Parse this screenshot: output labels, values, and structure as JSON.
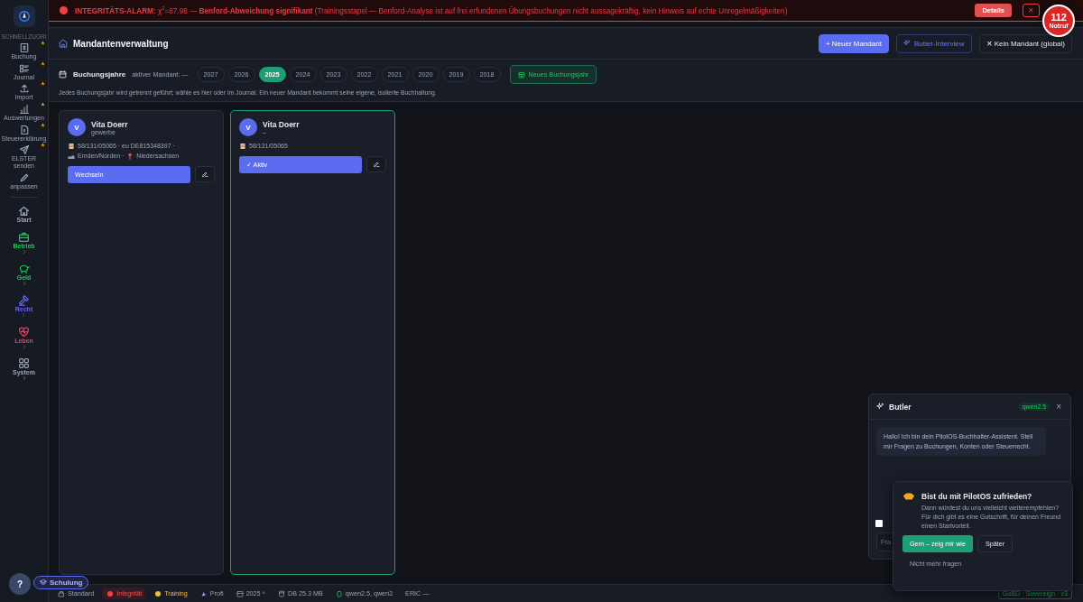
{
  "alarm": {
    "message": "**INTEGRITÄTS-ALARM:** χ$^{2}$=87.98 — **Benford-Abweichung signifikant** (Trainingsstapel — Benford-Analyse ist auf frei erfundenen Übungsbuchungen nicht aussagekräftig, kein Hinweis auf echte Unregelmäßigkeiten)",
    "details_button": "Details",
    "close_button": "✕"
  },
  "emergency": {
    "number": "112",
    "label": "Notruf"
  },
  "sidebar": {
    "section": "SCHNELLZUGRI",
    "quick": [
      {
        "label": "Buchung",
        "starred": true
      },
      {
        "label": "Journal",
        "starred": true
      },
      {
        "label": "Import",
        "starred": true
      },
      {
        "label": "Auswertungen",
        "starred": true
      },
      {
        "label": "Steuererklärung",
        "starred": true
      },
      {
        "label": "ELSTER senden",
        "starred": true
      },
      {
        "label": "anpassen",
        "starred": false
      }
    ],
    "areas": [
      {
        "label": "Start",
        "color": "#9aa3b5",
        "expandable": false
      },
      {
        "label": "Betrieb",
        "color": "#22c55e",
        "expandable": true
      },
      {
        "label": "Geld",
        "color": "#22c55e",
        "expandable": true
      },
      {
        "label": "Recht",
        "color": "#6366f1",
        "expandable": true
      },
      {
        "label": "Leben",
        "color": "#f43f5e",
        "expandable": true
      },
      {
        "label": "System",
        "color": "#9aa3b5",
        "expandable": true
      }
    ]
  },
  "page": {
    "title": "Mandantenverwaltung",
    "buttons": [
      {
        "label": "+ Neuer Mandant",
        "kind": "primary"
      },
      {
        "label": "Butler-Interview",
        "kind": "outline"
      },
      {
        "label": "✕ Kein Mandant (global)",
        "kind": "plain"
      }
    ]
  },
  "years": {
    "title": "Buchungsjahre",
    "active_client": "aktiver Mandant: —",
    "items": [
      {
        "label": "2027",
        "selected": false
      },
      {
        "label": "2026",
        "selected": false
      },
      {
        "label": "2025",
        "selected": true
      },
      {
        "label": "2024",
        "selected": false
      },
      {
        "label": "2023",
        "selected": false
      },
      {
        "label": "2022",
        "selected": false
      },
      {
        "label": "2021",
        "selected": false
      },
      {
        "label": "2020",
        "selected": false
      },
      {
        "label": "2019",
        "selected": false
      },
      {
        "label": "2018",
        "selected": false
      }
    ],
    "new_button": "Neues Buchungsjahr",
    "hint": "Jedes Buchungsjahr wird getrennt geführt; wähle es hier oder im Journal. Ein neuer Mandant bekommt seine eigene, isolierte Buchhaltung."
  },
  "clients": [
    {
      "initial": "V",
      "name": "Vita Doerr",
      "type": "gewerbe",
      "details": [
        "58/131/05065 · eu DE815348397 ·",
        "Emden/Norden ·",
        "Niedersachsen"
      ],
      "active": false,
      "button": "Wechseln"
    },
    {
      "initial": "V",
      "name": "Vita Doerr",
      "type": "–",
      "details": [
        "58/131/05065"
      ],
      "active": true,
      "button": "✓ Aktiv"
    }
  ],
  "help_button": "?",
  "training_badge": "Schulung",
  "status_bar": {
    "items": [
      {
        "label": "Standard",
        "kind": "plain"
      },
      {
        "label": "Integrität",
        "kind": "alert"
      },
      {
        "label": "Training",
        "kind": "warn"
      },
      {
        "label": "Profi",
        "kind": "plain"
      },
      {
        "label": "2025 ^",
        "kind": "plain"
      },
      {
        "label": "DB 25.3 MB",
        "kind": "plain"
      },
      {
        "label": "qwen2.5, qwen3",
        "kind": "model"
      },
      {
        "label": "ERIC —",
        "kind": "plain"
      }
    ],
    "version": "GoBD · Sovereign · v3"
  },
  "butler": {
    "title": "Butler",
    "model": "qwen2.5",
    "close": "×",
    "message": "Hallo! Ich bin dein PilotOS-Buchhalter-Assistent. Stell mir Fragen zu Buchungen, Konten oder Steuerrecht.",
    "checked": false,
    "placeholder": "Fra"
  },
  "rating": {
    "title": "Bist du mit PilotOS zufrieden?",
    "text": "Dann würdest du uns vielleicht weiterempfehlen? Für dich gibt es eine Gutschrift, für deinen Freund einen Startvorteil.",
    "accept": "Gern – zeig mir wie",
    "later": "Später",
    "never": "Nicht mehr fragen"
  }
}
